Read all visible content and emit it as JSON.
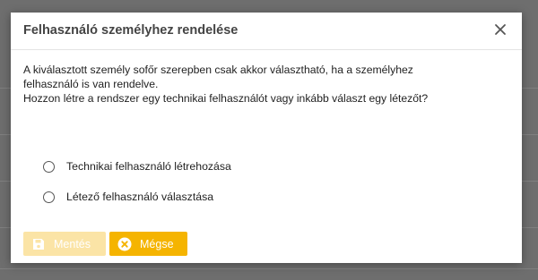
{
  "dialog": {
    "title": "Felhasználó személyhez rendelése",
    "message_line1": "A kiválasztott személy sofőr szerepben csak akkor választható, ha a személyhez",
    "message_line2": "felhasználó is van rendelve.",
    "message_line3": "Hozzon létre a rendszer egy technikai felhasználót vagy inkább választ egy létezőt?",
    "options": [
      {
        "label": "Technikai felhasználó létrehozása",
        "selected": false
      },
      {
        "label": "Létező felhasználó választása",
        "selected": false
      }
    ],
    "buttons": {
      "save_label": "Mentés",
      "save_enabled": false,
      "cancel_label": "Mégse"
    }
  },
  "colors": {
    "accent": "#f5b400",
    "accent_disabled": "#fbe4a6",
    "overlay": "#6e6e6e"
  },
  "icons": {
    "close": "close-icon",
    "save": "floppy-disk-icon",
    "cancel": "cancel-circle-icon"
  }
}
